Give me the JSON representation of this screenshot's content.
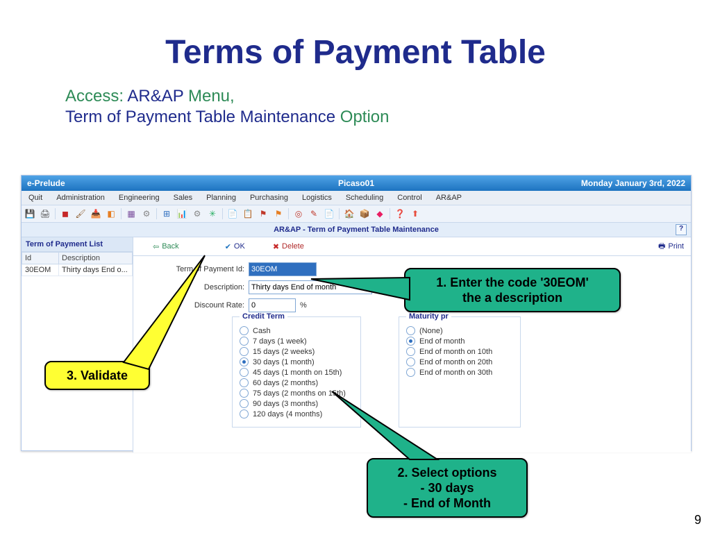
{
  "slide": {
    "title": "Terms of Payment Table",
    "access_word": "Access:",
    "access_menu": "AR&AP",
    "access_menu_word": "Menu,",
    "access_line2": "Term of Payment Table Maintenance",
    "access_option": "Option",
    "page_number": "9"
  },
  "app": {
    "product": "e-Prelude",
    "user": "Picaso01",
    "date": "Monday January 3rd, 2022",
    "menus": [
      "Quit",
      "Administration",
      "Engineering",
      "Sales",
      "Planning",
      "Purchasing",
      "Logistics",
      "Scheduling",
      "Control",
      "AR&AP"
    ],
    "section_title": "AR&AP - Term of Payment Table Maintenance",
    "sidebar_title": "Term of Payment List",
    "sidebar_cols": [
      "Id",
      "Description"
    ],
    "sidebar_row": [
      "30EOM",
      "Thirty days End o..."
    ],
    "actions": {
      "back": "Back",
      "ok": "OK",
      "delete": "Delete",
      "print": "Print"
    },
    "form": {
      "id_label": "Term of Payment Id:",
      "id_value": "30EOM",
      "desc_label": "Description:",
      "desc_value": "Thirty days End of month",
      "rate_label": "Discount Rate:",
      "rate_value": "0",
      "rate_unit": "%"
    },
    "credit_legend": "Credit Term",
    "credit_terms": [
      {
        "label": "Cash",
        "selected": false
      },
      {
        "label": "7 days (1 week)",
        "selected": false
      },
      {
        "label": "15 days (2 weeks)",
        "selected": false
      },
      {
        "label": "30 days (1 month)",
        "selected": true
      },
      {
        "label": "45 days (1 month on 15th)",
        "selected": false
      },
      {
        "label": "60 days (2 months)",
        "selected": false
      },
      {
        "label": "75 days (2 months on 15th)",
        "selected": false
      },
      {
        "label": "90 days (3 months)",
        "selected": false
      },
      {
        "label": "120 days (4 months)",
        "selected": false
      }
    ],
    "maturity_legend": "Maturity pr",
    "maturity": [
      {
        "label": "(None)",
        "selected": false
      },
      {
        "label": "End of month",
        "selected": true
      },
      {
        "label": "End of month on 10th",
        "selected": false
      },
      {
        "label": "End of month on 20th",
        "selected": false
      },
      {
        "label": "End of month on 30th",
        "selected": false
      }
    ]
  },
  "callouts": {
    "c1_l1": "1. Enter the code '30EOM'",
    "c1_l2": "the a description",
    "c2_l1": "2. Select options",
    "c2_l2": "- 30 days",
    "c2_l3": "- End of Month",
    "c3": "3. Validate"
  },
  "toolbar_icons": [
    "save-icon",
    "print-icon",
    "red-square-icon",
    "brush-icon",
    "inbox-icon",
    "orange-square-icon",
    "grid-icon",
    "gear-icon",
    "table-icon",
    "bar-chart-icon",
    "config-icon",
    "green-gear-icon",
    "yellow-doc-icon",
    "clipboard-icon",
    "flag-icon",
    "orange-flag-icon",
    "target-icon",
    "edit-doc-icon",
    "green-doc-icon",
    "house-icon",
    "box-icon",
    "pink-icon",
    "help-icon",
    "up-arrow-icon"
  ],
  "toolbar_glyphs": [
    "💾",
    "🖨",
    "◼",
    "🖌",
    "📥",
    "◧",
    "▦",
    "⚙",
    "⊞",
    "📊",
    "⚙",
    "✳",
    "📄",
    "📋",
    "⚑",
    "⚑",
    "◎",
    "✎",
    "📄",
    "🏠",
    "📦",
    "◆",
    "❓",
    "⬆"
  ]
}
